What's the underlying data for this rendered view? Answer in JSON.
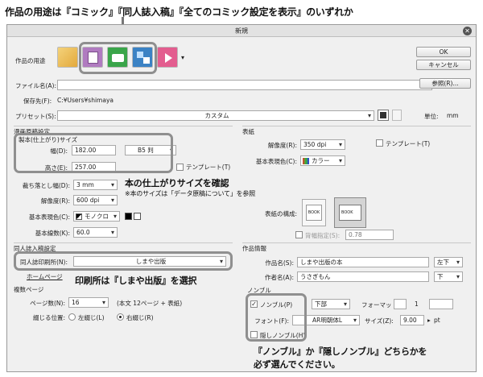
{
  "top_note": "作品の用途は『コミック』『同人誌入稿』『全てのコミック設定を表示』のいずれか",
  "window": {
    "title": "新規",
    "ok": "OK",
    "cancel": "キャンセル"
  },
  "usage": {
    "label": "作品の用途",
    "icons": [
      "illustration-icon",
      "comic-icon",
      "doujinshi-icon",
      "all-comic-settings-icon",
      "animation-icon"
    ]
  },
  "filename": {
    "label": "ファイル名(A):",
    "value": ""
  },
  "save_to": {
    "label": "保存先(F):",
    "value": "C:¥Users¥shimaya",
    "browse": "参照(R)..."
  },
  "preset": {
    "label": "プリセット(S):",
    "value": "カスタム",
    "unit_label": "単位:",
    "unit": "mm"
  },
  "manuscript": {
    "section": "漫画原稿設定",
    "size_group": "製本(仕上がり)サイズ",
    "width_label": "幅(D):",
    "width": "182.00",
    "height_label": "高さ(E):",
    "height": "257.00",
    "size_preset": "B5 判",
    "template_label": "テンプレート(T)",
    "bleed_label": "裁ち落とし幅(D):",
    "bleed": "3 mm",
    "res_label": "解像度(R):",
    "resolution": "600 dpi",
    "color_label": "基本表現色(C):",
    "color": "モノクロ",
    "lines_label": "基本線数(K):",
    "lines": "60.0"
  },
  "annotation_size": {
    "line1": "本の仕上がりサイズを確認",
    "line2": "※本のサイズは「データ原稿について」を参照"
  },
  "doujin": {
    "section": "同人誌入稿設定",
    "printer_label": "同人誌印刷所(N):",
    "printer": "しまや出版",
    "homepage": "ホームページ"
  },
  "annotation_printer": "印刷所は『しまや出版』を選択",
  "multipage": {
    "section": "複数ページ",
    "pages_label": "ページ数(N):",
    "pages": "16",
    "pages_note": "(本文 12ページ + 表紙)",
    "binding_label": "綴じる位置:",
    "left_bind": "左綴じ(L)",
    "right_bind": "右綴じ(R)"
  },
  "cover": {
    "section": "表紙",
    "res_label": "解像度(R):",
    "resolution": "350 dpi",
    "color_label": "基本表現色(C):",
    "color": "カラー",
    "template_label": "テンプレート(T)",
    "composition_label": "表紙の構成:",
    "spine_label": "背幅指定(S):",
    "spine": "0.78",
    "book_text": "BOOK"
  },
  "work_info": {
    "section": "作品情報",
    "title_label": "作品名(S):",
    "title": "しまや出版の本",
    "title_pos": "左下",
    "author_label": "作者名(A):",
    "author": "うさぎもん",
    "author_pos": "下"
  },
  "nombre": {
    "section": "ノンブル",
    "label": "ノンブル(P)",
    "position": "下部",
    "format_label": "フォーマット:",
    "format_value": "1",
    "font_label": "フォント(F):",
    "font": "AR明朝体L",
    "size_label": "サイズ(Z):",
    "size": "9.00",
    "unit": "pt",
    "hidden_label": "隠しノンブル(H)"
  },
  "annotation_nombre": {
    "line1": "『ノンブル』か『隠しノンブル』どちらかを",
    "line2": "必ず選んでください。"
  }
}
